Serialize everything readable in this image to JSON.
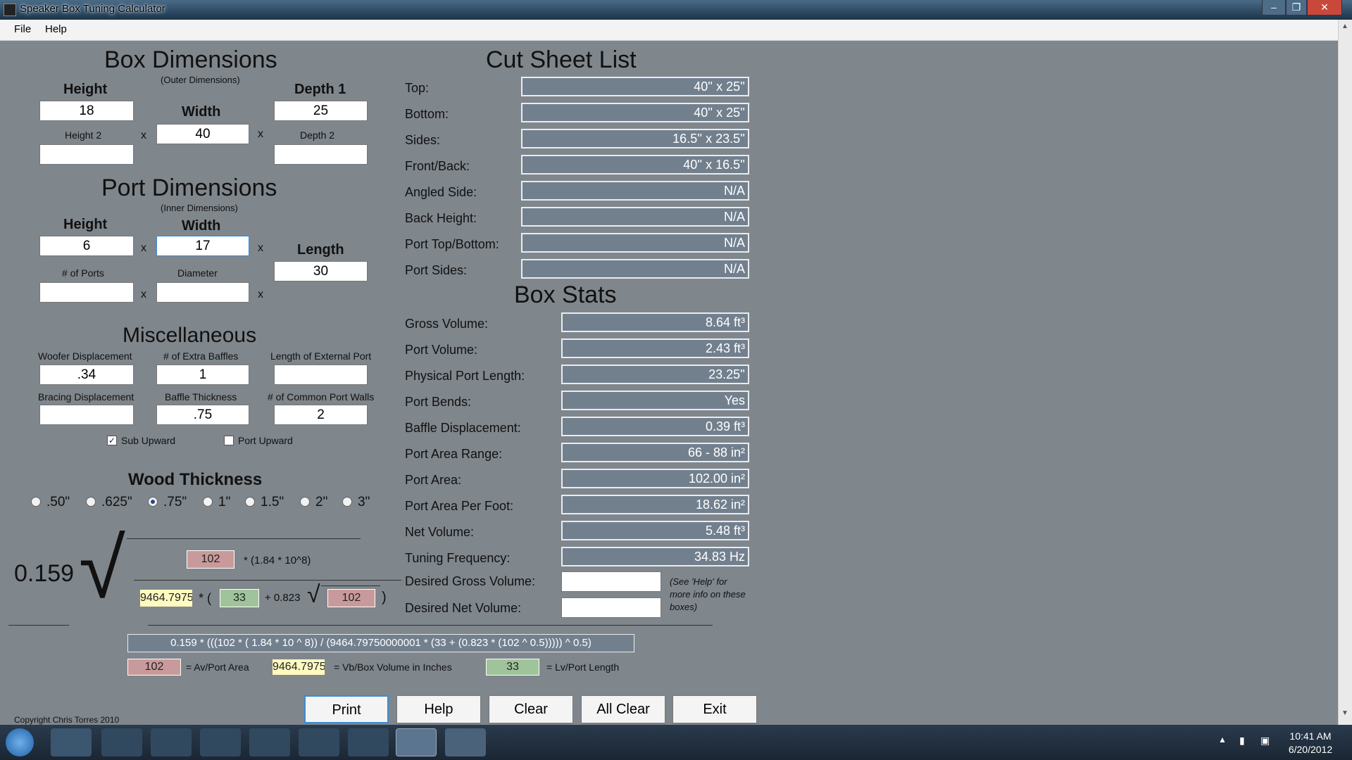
{
  "window": {
    "title": "Speaker Box Tuning Calculator",
    "minimize": "–",
    "maximize": "❐",
    "close": "✕"
  },
  "menu": {
    "file": "File",
    "help": "Help"
  },
  "box_dimensions": {
    "title": "Box Dimensions",
    "subtitle": "(Outer Dimensions)",
    "height_label": "Height",
    "height_value": "18",
    "width_label": "Width",
    "width_value": "40",
    "depth1_label": "Depth 1",
    "depth1_value": "25",
    "height2_label": "Height 2",
    "height2_value": "",
    "depth2_label": "Depth 2",
    "depth2_value": "",
    "x": "x"
  },
  "port_dimensions": {
    "title": "Port Dimensions",
    "subtitle": "(Inner Dimensions)",
    "height_label": "Height",
    "height_value": "6",
    "width_label": "Width",
    "width_value": "17",
    "length_label": "Length",
    "length_value": "30",
    "ports_label": "# of Ports",
    "ports_value": "",
    "diameter_label": "Diameter",
    "diameter_value": ""
  },
  "misc": {
    "title": "Miscellaneous",
    "woofer_label": "Woofer Displacement",
    "woofer_value": ".34",
    "baffles_label": "# of Extra Baffles",
    "baffles_value": "1",
    "ext_port_label": "Length of External Port",
    "ext_port_value": "",
    "bracing_label": "Bracing Displacement",
    "bracing_value": "",
    "baffle_thick_label": "Baffle Thickness",
    "baffle_thick_value": ".75",
    "common_walls_label": "# of Common Port Walls",
    "common_walls_value": "2",
    "sub_upward_label": "Sub Upward",
    "sub_upward_checked": true,
    "port_upward_label": "Port Upward",
    "port_upward_checked": false
  },
  "wood": {
    "title": "Wood Thickness",
    "options": [
      ".50\"",
      ".625\"",
      ".75\"",
      "1\"",
      "1.5\"",
      "2\"",
      "3\""
    ],
    "selected_index": 2
  },
  "formula": {
    "constant": "0.159",
    "av_value": "102",
    "numerator_tail": "* (1.84 * 10^8)",
    "vb_value": "9464.7975",
    "mult_open": "* (",
    "lv_value": "33",
    "plus_coef": "+ 0.823",
    "av_value2": "102",
    "close_paren": ")",
    "expression": "0.159 * (((102 * ( 1.84 * 10 ^ 8)) / (9464.79750000001 * (33 + (0.823 * (102 ^ 0.5))))) ^ 0.5)",
    "legend_av_value": "102",
    "legend_av_label": "= Av/Port Area",
    "legend_vb_value": "9464.7975",
    "legend_vb_label": "= Vb/Box Volume in Inches",
    "legend_lv_value": "33",
    "legend_lv_label": "= Lv/Port Length"
  },
  "cut_sheet": {
    "title": "Cut Sheet List",
    "rows": [
      {
        "label": "Top:",
        "value": "40'' x 25''"
      },
      {
        "label": "Bottom:",
        "value": "40'' x 25''"
      },
      {
        "label": "Sides:",
        "value": "16.5'' x 23.5''"
      },
      {
        "label": "Front/Back:",
        "value": "40'' x 16.5''"
      },
      {
        "label": "Angled Side:",
        "value": "N/A"
      },
      {
        "label": "Back Height:",
        "value": "N/A"
      },
      {
        "label": "Port Top/Bottom:",
        "value": "N/A"
      },
      {
        "label": "Port Sides:",
        "value": "N/A"
      }
    ]
  },
  "box_stats": {
    "title": "Box Stats",
    "rows": [
      {
        "label": "Gross Volume:",
        "value": "8.64 ft³"
      },
      {
        "label": "Port Volume:",
        "value": "2.43 ft³"
      },
      {
        "label": "Physical Port Length:",
        "value": "23.25''"
      },
      {
        "label": "Port Bends:",
        "value": "Yes"
      },
      {
        "label": "Baffle Displacement:",
        "value": "0.39 ft³"
      },
      {
        "label": "Port Area Range:",
        "value": "66 - 88 in²"
      },
      {
        "label": "Port Area:",
        "value": "102.00 in²"
      },
      {
        "label": "Port Area Per Foot:",
        "value": "18.62 in²"
      },
      {
        "label": "Net Volume:",
        "value": "5.48 ft³"
      },
      {
        "label": "Tuning Frequency:",
        "value": "34.83 Hz"
      }
    ],
    "desired_gross_label": "Desired Gross Volume:",
    "desired_gross_value": "",
    "desired_net_label": "Desired Net Volume:",
    "desired_net_value": "",
    "help_note": "(See 'Help' for more info on these boxes)"
  },
  "buttons": {
    "print": "Print",
    "help": "Help",
    "clear": "Clear",
    "all_clear": "All Clear",
    "exit": "Exit"
  },
  "copyright": "Copyright Chris Torres 2010",
  "taskbar": {
    "time": "10:41 AM",
    "date": "6/20/2012"
  }
}
